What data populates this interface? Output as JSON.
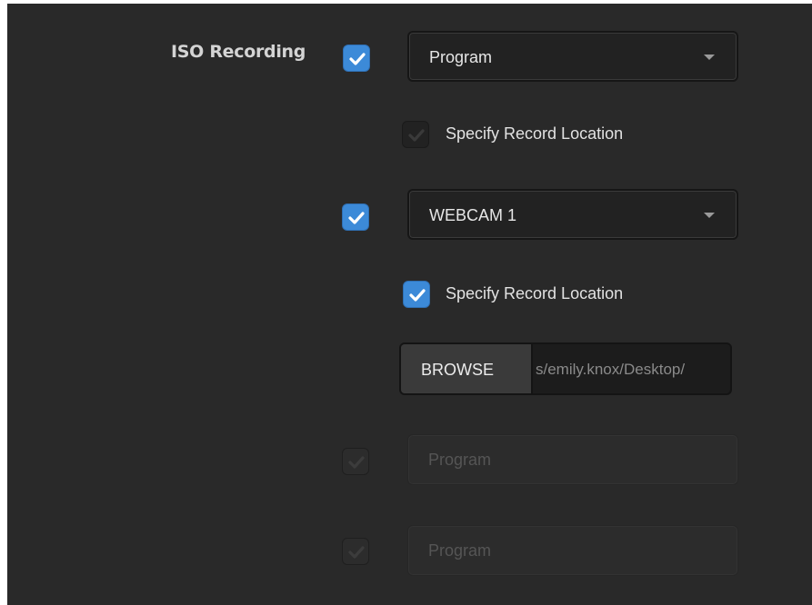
{
  "iso_recording": {
    "label": "ISO Recording",
    "entries": [
      {
        "enabled": true,
        "source": "Program",
        "specify_location": {
          "label": "Specify Record Location",
          "checked": false
        }
      },
      {
        "enabled": true,
        "source": "WEBCAM 1",
        "specify_location": {
          "label": "Specify Record Location",
          "checked": true
        },
        "browse": {
          "label": "BROWSE",
          "path": "s/emily.knox/Desktop/"
        }
      },
      {
        "enabled": false,
        "disabled": true,
        "source": "Program"
      },
      {
        "enabled": false,
        "disabled": true,
        "source": "Program"
      }
    ]
  },
  "colors": {
    "accent": "#3c8ad8",
    "background": "#292929"
  },
  "icons": {
    "check": "check-icon",
    "caret": "chevron-down-icon"
  }
}
